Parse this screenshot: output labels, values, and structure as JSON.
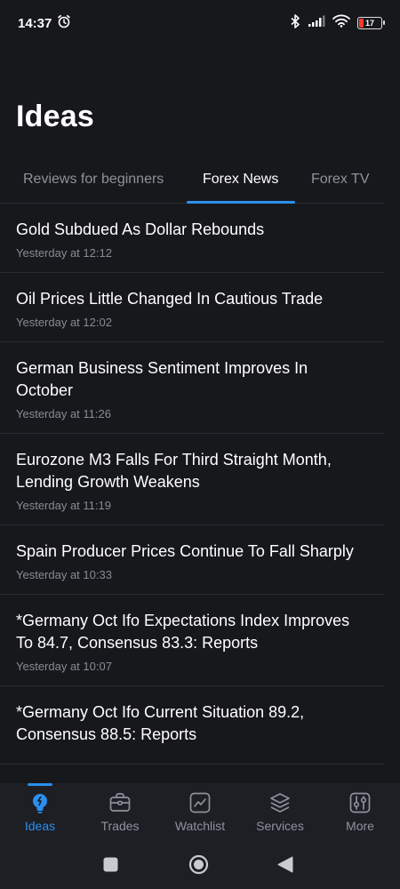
{
  "status_bar": {
    "time": "14:37",
    "battery": "17"
  },
  "page": {
    "title": "Ideas"
  },
  "tabs": [
    {
      "label": "Reviews for beginners",
      "active": false
    },
    {
      "label": "Forex News",
      "active": true
    },
    {
      "label": "Forex TV",
      "active": false
    }
  ],
  "news": [
    {
      "title": "Gold Subdued As Dollar Rebounds",
      "time": "Yesterday at 12:12"
    },
    {
      "title": "Oil Prices Little Changed In Cautious Trade",
      "time": "Yesterday at 12:02"
    },
    {
      "title": "German Business Sentiment Improves In October",
      "time": "Yesterday at 11:26"
    },
    {
      "title": "Eurozone M3 Falls For Third Straight Month, Lending Growth Weakens",
      "time": "Yesterday at 11:19"
    },
    {
      "title": "Spain Producer Prices Continue To Fall Sharply",
      "time": "Yesterday at 10:33"
    },
    {
      "title": "*Germany Oct Ifo Expectations Index Improves To 84.7, Consensus 83.3: Reports",
      "time": "Yesterday at 10:07"
    },
    {
      "title": "*Germany Oct Ifo Current Situation 89.2, Consensus 88.5: Reports",
      "time": ""
    }
  ],
  "bottom_nav": [
    {
      "label": "Ideas",
      "icon": "lightbulb-icon",
      "active": true
    },
    {
      "label": "Trades",
      "icon": "briefcase-icon",
      "active": false
    },
    {
      "label": "Watchlist",
      "icon": "chart-icon",
      "active": false
    },
    {
      "label": "Services",
      "icon": "layers-icon",
      "active": false
    },
    {
      "label": "More",
      "icon": "sliders-icon",
      "active": false
    }
  ],
  "colors": {
    "background": "#17181c",
    "accent": "#2b8ff0",
    "muted_text": "#868b95",
    "nav_background": "#1d1f25"
  }
}
